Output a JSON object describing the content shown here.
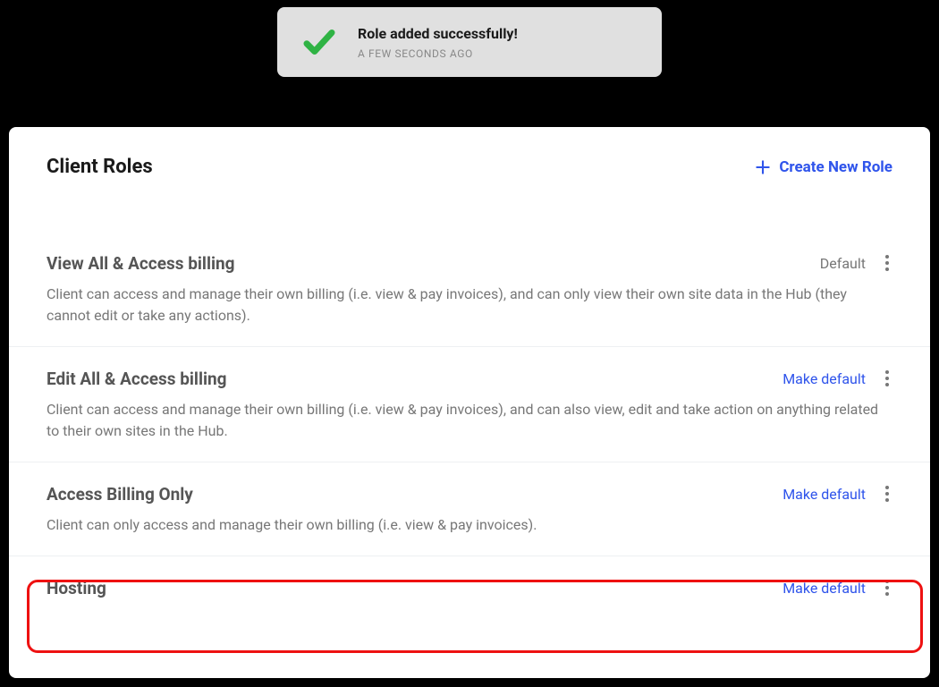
{
  "toast": {
    "message": "Role added successfully!",
    "time": "A FEW SECONDS AGO"
  },
  "panel": {
    "title": "Client Roles",
    "create_label": "Create New Role"
  },
  "labels": {
    "default": "Default",
    "make_default": "Make default"
  },
  "roles": [
    {
      "name": "View All & Access billing",
      "desc": "Client can access and manage their own billing (i.e. view & pay invoices), and can only view their own site data in the Hub (they cannot edit or take any actions).",
      "is_default": true
    },
    {
      "name": "Edit All & Access billing",
      "desc": "Client can access and manage their own billing (i.e. view & pay invoices), and can also view, edit and take action on anything related to their own sites in the Hub.",
      "is_default": false
    },
    {
      "name": "Access Billing Only",
      "desc": "Client can only access and manage their own billing (i.e. view & pay invoices).",
      "is_default": false
    },
    {
      "name": "Hosting",
      "desc": "",
      "is_default": false
    }
  ]
}
